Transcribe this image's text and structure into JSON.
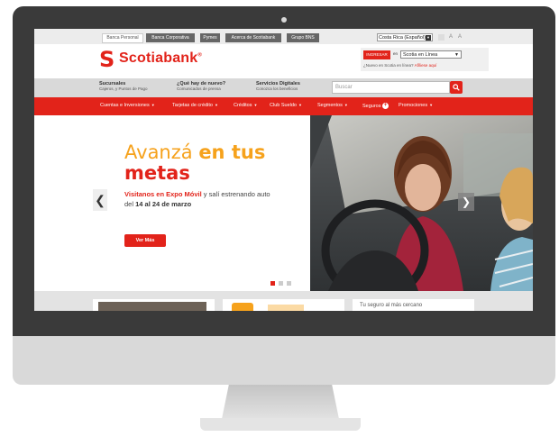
{
  "top_tabs": [
    "Banca Personal",
    "Banca Corporativa",
    "Pymes",
    "Acerca de Scotiabank",
    "Grupo BNS"
  ],
  "country_select": "Costa Rica (Español)",
  "logo_text": "Scotiabank",
  "logo_registered": "®",
  "login": {
    "button": "INGRESAR",
    "en": "en",
    "select_value": "Scotia en Línea",
    "new_text": "¿Nuevo en Scotia en línea?",
    "new_link": "Afíliese aquí"
  },
  "info": [
    {
      "title": "Sucursales",
      "sub": "Cajeros, y Puntos de Pago"
    },
    {
      "title": "¿Qué hay de nuevo?",
      "sub": "Comunicados de prensa"
    },
    {
      "title": "Servicios Digitales",
      "sub": "Conozca los beneficios"
    }
  ],
  "search_placeholder": "Buscar",
  "nav": [
    "Cuentas e Inversiones",
    "Tarjetas de crédito",
    "Créditos",
    "Club Sueldo",
    "Segmentos",
    "Seguros",
    "Promociones"
  ],
  "hero": {
    "line1_a": "Avanzá ",
    "line1_b": "en ",
    "line1_c": "tus",
    "line2": "metas",
    "sub_red": "Visitanos en Expo Móvil",
    "sub_rest": " y salí estrenando auto",
    "sub2_a": "del ",
    "sub2_b": "14 al 24 de marzo",
    "cta": "Ver Más"
  },
  "card3_text": "Tu seguro al más cercano",
  "colors": {
    "brand_red": "#e2231a",
    "accent_orange": "#f6a21c"
  }
}
